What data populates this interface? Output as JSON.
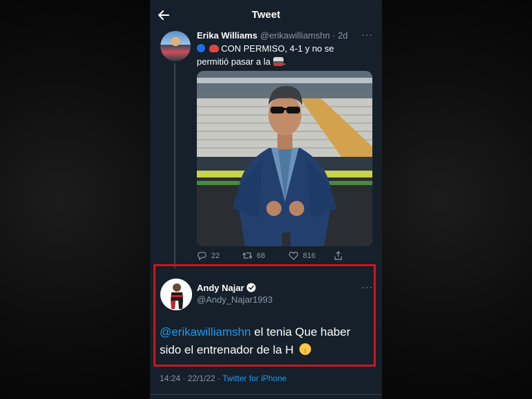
{
  "header": {
    "title": "Tweet"
  },
  "tweet1": {
    "author_name": "Erika Williams",
    "author_handle": "@erikawilliamshn · 2d",
    "text_1": "CON PERMISO, 4-1 y no se",
    "text_2": "permitió pasar a la",
    "text_end": ".",
    "more": "···",
    "replies": "22",
    "retweets": "68",
    "likes": "816"
  },
  "tweet2": {
    "author_name": "Andy Najar",
    "author_handle": "@Andy_Najar1993",
    "mention": "@erikawilliamshn",
    "text_1": " el tenia Que haber",
    "text_2": "sido el entrenador de la H",
    "more": "···"
  },
  "meta": {
    "time": "14:24 · 22/1/22 · ",
    "source": "Twitter for iPhone"
  },
  "colors": {
    "background": "#15202b",
    "accent": "#1d9bf0",
    "highlight": "#d0141b",
    "muted": "#8899a6"
  }
}
